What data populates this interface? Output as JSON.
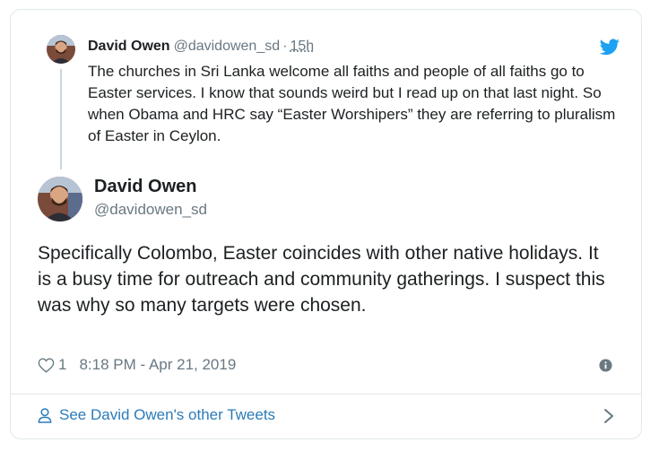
{
  "parent_tweet": {
    "name": "David Owen",
    "handle": "@davidowen_sd",
    "separator": "·",
    "time": "15h",
    "text": "The churches in Sri Lanka welcome all faiths and people of all faiths go to Easter services. I know that sounds weird but I read up on that last night.  So when Obama and HRC say “Easter Worshipers” they are referring to pluralism of Easter in Ceylon.",
    "logo_icon": "twitter-bird-icon"
  },
  "main_tweet": {
    "name": "David Owen",
    "handle": "@davidowen_sd",
    "text": "Specifically Colombo, Easter coincides with other native holidays. It is a busy time for outreach and community gatherings.  I suspect this was why so many targets were chosen.",
    "likes": "1",
    "timestamp": "8:18 PM - Apr 21, 2019"
  },
  "footer": {
    "link_label": "See David Owen's other Tweets"
  },
  "colors": {
    "link": "#2b7bb9",
    "muted": "#697882",
    "twitter_blue": "#1da1f2",
    "border": "#e1e8ed"
  }
}
